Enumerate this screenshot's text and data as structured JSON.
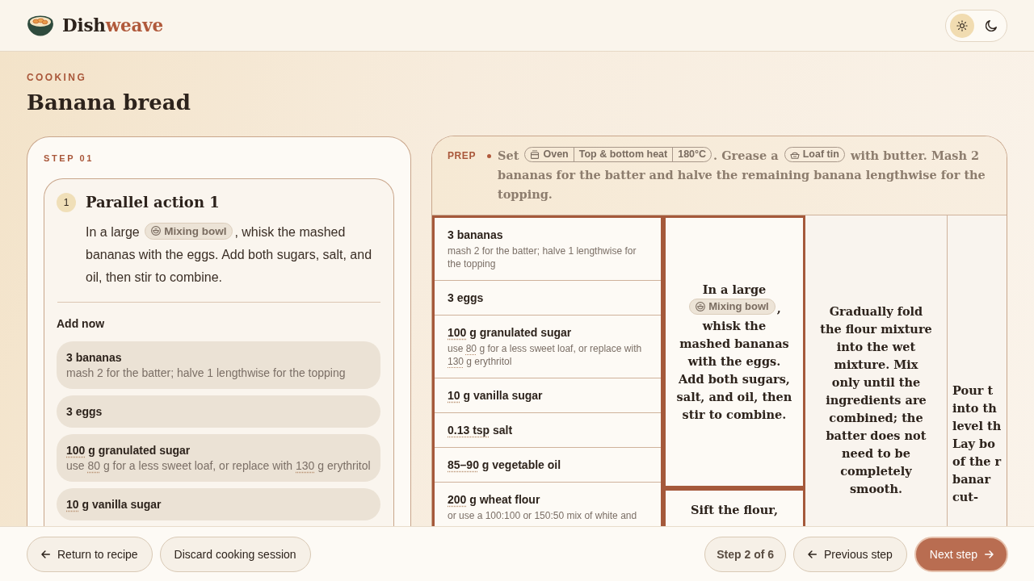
{
  "header": {
    "brand": {
      "text": "Dish",
      "accent": "weave"
    },
    "theme_toggle": [
      {
        "kind": "light",
        "selected": true
      },
      {
        "kind": "dark",
        "selected": false
      }
    ]
  },
  "page": {
    "eyebrow": "COOKING",
    "title": "Banana bread"
  },
  "step_card": {
    "label": "STEP 01",
    "action": {
      "number": "1",
      "title": "Parallel action 1",
      "text": [
        {
          "kind": "text",
          "text": "In a large "
        },
        {
          "kind": "bowl",
          "text": "Mixing bowl"
        },
        {
          "kind": "text",
          "text": ", whisk the mashed bananas with the eggs. Add both sugars, salt, and oil, then stir to combine."
        }
      ],
      "add_now": "Add now",
      "ingredients": [
        {
          "name": [
            {
              "kind": "text",
              "text": "3 bananas"
            }
          ],
          "note": [
            {
              "kind": "text",
              "text": "mash 2 for the batter; halve 1 lengthwise for the topping"
            }
          ]
        },
        {
          "name": [
            {
              "kind": "text",
              "text": "3 eggs"
            }
          ]
        },
        {
          "name": [
            {
              "kind": "qty",
              "text": "100"
            },
            {
              "kind": "text",
              "text": " g granulated sugar"
            }
          ],
          "note": [
            {
              "kind": "text",
              "text": "use "
            },
            {
              "kind": "qty",
              "text": "80"
            },
            {
              "kind": "text",
              "text": " g for a less sweet loaf, or replace with "
            },
            {
              "kind": "qty",
              "text": "130"
            },
            {
              "kind": "text",
              "text": " g erythritol"
            }
          ]
        },
        {
          "name": [
            {
              "kind": "qty",
              "text": "10"
            },
            {
              "kind": "text",
              "text": " g vanilla sugar"
            }
          ]
        }
      ]
    }
  },
  "timeline": {
    "prep": {
      "label": "PREP",
      "text": [
        {
          "kind": "text",
          "text": "Set "
        },
        {
          "kind": "oven",
          "parts": [
            "Oven",
            "Top & bottom heat",
            "180°C"
          ]
        },
        {
          "kind": "text",
          "text": ". Grease a "
        },
        {
          "kind": "tin",
          "text": "Loaf tin"
        },
        {
          "kind": "text",
          "text": " with butter. Mash 2 bananas for the batter and halve the remaining banana lengthwise for the topping."
        }
      ]
    },
    "columns": [
      {
        "kind": "ingredients",
        "active": true,
        "rows": [
          {
            "name": [
              {
                "kind": "text",
                "text": "3 bananas"
              }
            ],
            "note": [
              {
                "kind": "text",
                "text": "mash 2 for the batter; halve 1 lengthwise for the topping"
              }
            ]
          },
          {
            "name": [
              {
                "kind": "text",
                "text": "3 eggs"
              }
            ]
          },
          {
            "name": [
              {
                "kind": "qty",
                "text": "100"
              },
              {
                "kind": "text",
                "text": " g granulated sugar"
              }
            ],
            "note": [
              {
                "kind": "text",
                "text": "use "
              },
              {
                "kind": "qty",
                "text": "80"
              },
              {
                "kind": "text",
                "text": " g for a less sweet loaf, or replace with "
              },
              {
                "kind": "qty",
                "text": "130"
              },
              {
                "kind": "text",
                "text": " g erythritol"
              }
            ]
          },
          {
            "name": [
              {
                "kind": "qty",
                "text": "10"
              },
              {
                "kind": "text",
                "text": " g vanilla sugar"
              }
            ]
          },
          {
            "name": [
              {
                "kind": "qty",
                "text": "0.13 tsp"
              },
              {
                "kind": "text",
                "text": " salt"
              }
            ]
          },
          {
            "name": [
              {
                "kind": "qty",
                "text": "85–90"
              },
              {
                "kind": "text",
                "text": " g vegetable oil"
              }
            ]
          },
          {
            "name": [
              {
                "kind": "qty",
                "text": "200"
              },
              {
                "kind": "text",
                "text": " g wheat flour"
              }
            ],
            "note": [
              {
                "kind": "text",
                "text": "or use a 100:100 or 150:50 mix of white and"
              }
            ]
          }
        ]
      },
      {
        "kind": "steps",
        "cells": [
          {
            "active": true,
            "text": [
              {
                "kind": "text",
                "text": "In a large "
              },
              {
                "kind": "bowl",
                "text": "Mixing bowl"
              },
              {
                "kind": "text",
                "text": ", whisk the mashed bananas with the eggs. Add both sugars, salt, and oil, then stir to combine."
              }
            ]
          },
          {
            "active": true,
            "text": [
              {
                "kind": "text",
                "text": "Sift the flour,"
              }
            ]
          }
        ]
      },
      {
        "kind": "steps",
        "cells": [
          {
            "active": false,
            "text": [
              {
                "kind": "text",
                "text": "Gradually fold the flour mixture into the wet mixture. Mix only until the ingredients are combined; the batter does not need to be completely smooth."
              }
            ]
          }
        ]
      },
      {
        "kind": "edge",
        "cells": [
          {
            "active": false,
            "text": [
              {
                "kind": "text",
                "text": "Pour t\ninto th\nlevel th\nLay bo\nof the r\nbanar\ncut-"
              }
            ]
          }
        ]
      }
    ]
  },
  "footer": {
    "left": [
      {
        "kind": "back",
        "label": "Return to recipe"
      },
      {
        "kind": "plain",
        "label": "Discard cooking session"
      }
    ],
    "step_counter": "Step 2 of 6",
    "right": [
      {
        "kind": "back",
        "label": "Previous step"
      },
      {
        "kind": "next",
        "label": "Next step"
      }
    ]
  }
}
